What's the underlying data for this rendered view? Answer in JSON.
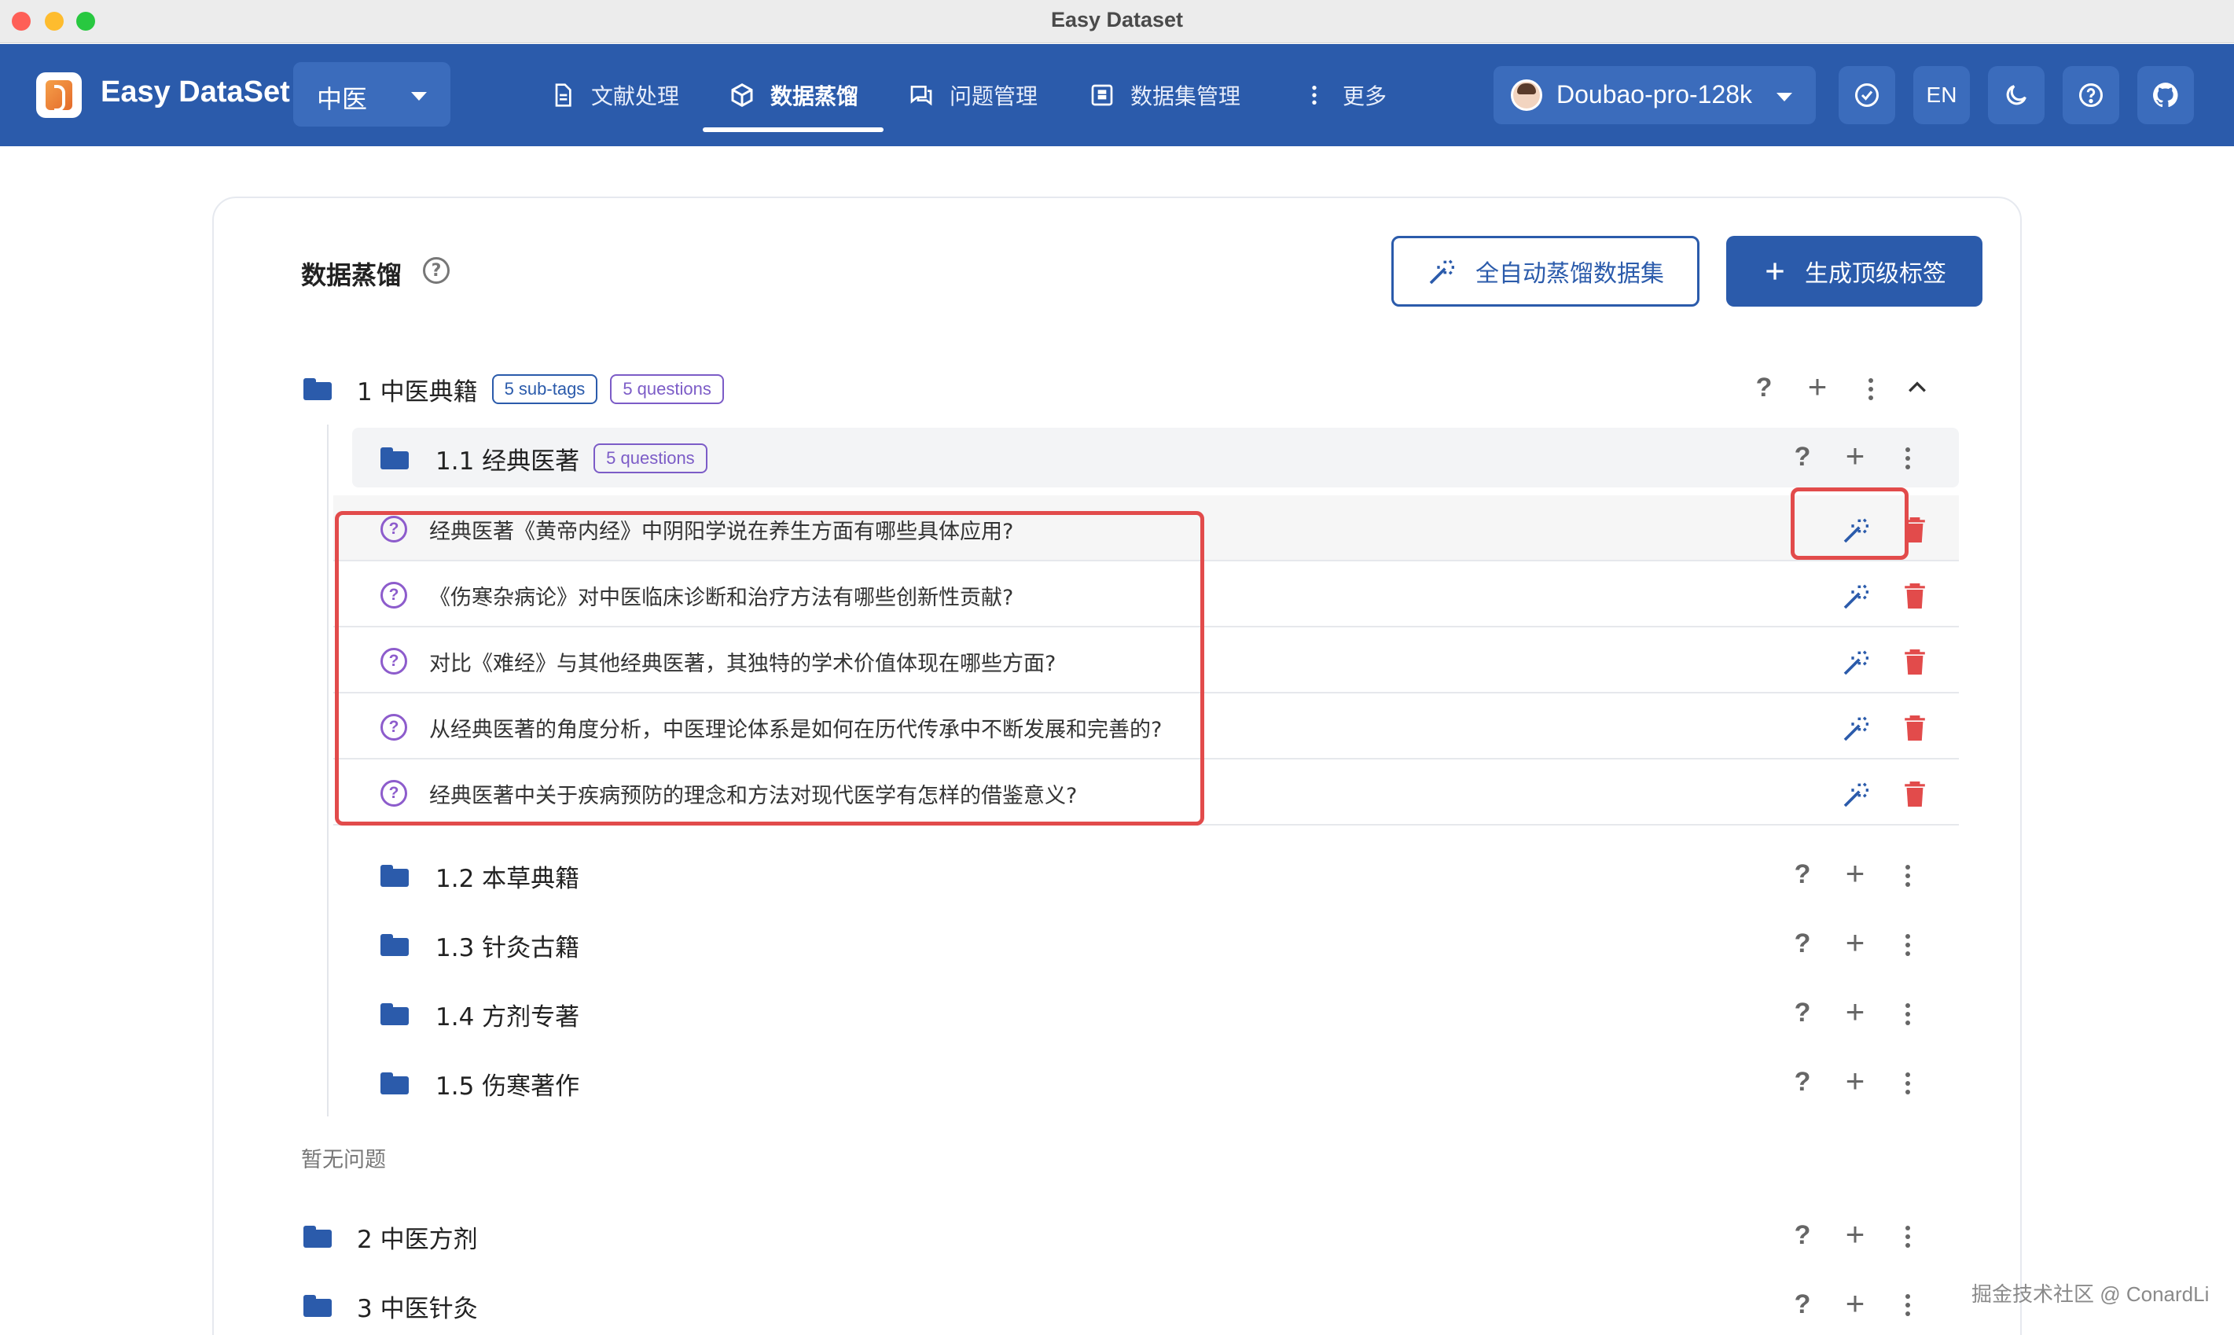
{
  "window": {
    "title": "Easy Dataset"
  },
  "appbar": {
    "brand": "Easy DataSet",
    "project": "中医",
    "nav": [
      {
        "label": "文献处理",
        "icon": "document-icon"
      },
      {
        "label": "数据蒸馏",
        "icon": "cube-icon",
        "active": true
      },
      {
        "label": "问题管理",
        "icon": "chat-icon"
      },
      {
        "label": "数据集管理",
        "icon": "grid-icon"
      },
      {
        "label": "更多",
        "icon": "more-vertical-icon"
      }
    ],
    "model": "Doubao-pro-128k",
    "lang": "EN"
  },
  "page": {
    "title": "数据蒸馏",
    "auto_button": "全自动蒸馏数据集",
    "gen_button": "生成顶级标签",
    "empty_note": "暂无问题"
  },
  "tree": {
    "root": {
      "label": "1 中医典籍",
      "subtags": "5 sub-tags",
      "questions": "5 questions"
    },
    "sub1": {
      "label": "1.1 经典医著",
      "questions": "5 questions"
    },
    "question_list": [
      "经典医著《黄帝内经》中阴阳学说在养生方面有哪些具体应用?",
      "《伤寒杂病论》对中医临床诊断和治疗方法有哪些创新性贡献?",
      "对比《难经》与其他经典医著，其独特的学术价值体现在哪些方面?",
      "从经典医著的角度分析，中医理论体系是如何在历代传承中不断发展和完善的?",
      "经典医著中关于疾病预防的理念和方法对现代医学有怎样的借鉴意义?"
    ],
    "sub_tags": [
      "1.2 本草典籍",
      "1.3 针灸古籍",
      "1.4 方剂专著",
      "1.5 伤寒著作"
    ],
    "top_tags": [
      "2 中医方剂",
      "3 中医针灸"
    ]
  },
  "icons": {
    "help": "?",
    "plus": "+"
  },
  "colors": {
    "primary": "#2b5bab",
    "danger": "#e24b4b",
    "question": "#8d5ccc"
  },
  "watermark": "掘金技术社区 @ ConardLi"
}
